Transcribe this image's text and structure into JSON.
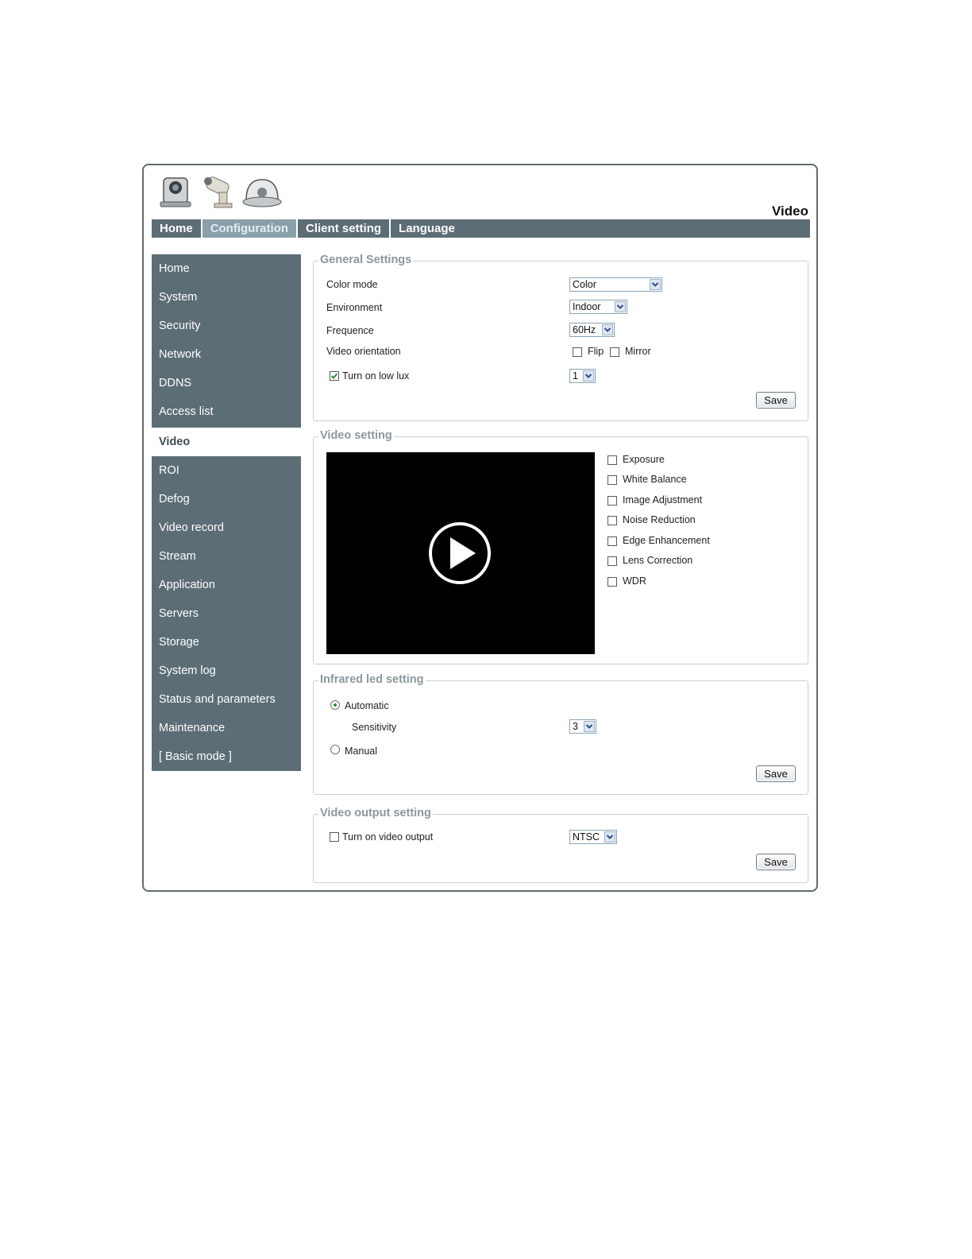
{
  "page_title": "Video",
  "topnav": [
    {
      "label": "Home",
      "active": false
    },
    {
      "label": "Configuration",
      "active": true
    },
    {
      "label": "Client setting",
      "active": false
    },
    {
      "label": "Language",
      "active": false
    }
  ],
  "sidebar": [
    {
      "label": "Home"
    },
    {
      "label": "System"
    },
    {
      "label": "Security"
    },
    {
      "label": "Network"
    },
    {
      "label": "DDNS"
    },
    {
      "label": "Access list"
    },
    {
      "label": "Video",
      "active": true
    },
    {
      "label": "ROI"
    },
    {
      "label": "Defog"
    },
    {
      "label": "Video record"
    },
    {
      "label": "Stream"
    },
    {
      "label": "Application"
    },
    {
      "label": "Servers"
    },
    {
      "label": "Storage"
    },
    {
      "label": "System log"
    },
    {
      "label": "Status and parameters"
    },
    {
      "label": "Maintenance"
    },
    {
      "label": "[ Basic mode ]"
    }
  ],
  "general": {
    "title": "General Settings",
    "color_mode_label": "Color mode",
    "color_mode_value": "Color",
    "environment_label": "Environment",
    "environment_value": "Indoor",
    "frequence_label": "Frequence",
    "frequence_value": "60Hz",
    "orientation_label": "Video orientation",
    "flip_label": "Flip",
    "flip_checked": false,
    "mirror_label": "Mirror",
    "mirror_checked": false,
    "low_lux_label": "Turn on low lux",
    "low_lux_checked": true,
    "low_lux_value": "1",
    "save_label": "Save"
  },
  "video_setting": {
    "title": "Video setting",
    "options": [
      {
        "label": "Exposure",
        "checked": false
      },
      {
        "label": "White Balance",
        "checked": false
      },
      {
        "label": "Image Adjustment",
        "checked": false
      },
      {
        "label": "Noise Reduction",
        "checked": false
      },
      {
        "label": "Edge Enhancement",
        "checked": false
      },
      {
        "label": "Lens Correction",
        "checked": false
      },
      {
        "label": "WDR",
        "checked": false
      }
    ]
  },
  "infrared": {
    "title": "Infrared led setting",
    "automatic_label": "Automatic",
    "automatic_selected": true,
    "sensitivity_label": "Sensitivity",
    "sensitivity_value": "3",
    "manual_label": "Manual",
    "manual_selected": false,
    "save_label": "Save"
  },
  "video_output": {
    "title": "Video output setting",
    "turn_on_label": "Turn on video output",
    "turn_on_checked": false,
    "standard_value": "NTSC",
    "save_label": "Save"
  },
  "colors": {
    "nav_bg": "#5c6d75",
    "nav_active": "#8aa0ab",
    "legend_text": "#8b979d"
  }
}
